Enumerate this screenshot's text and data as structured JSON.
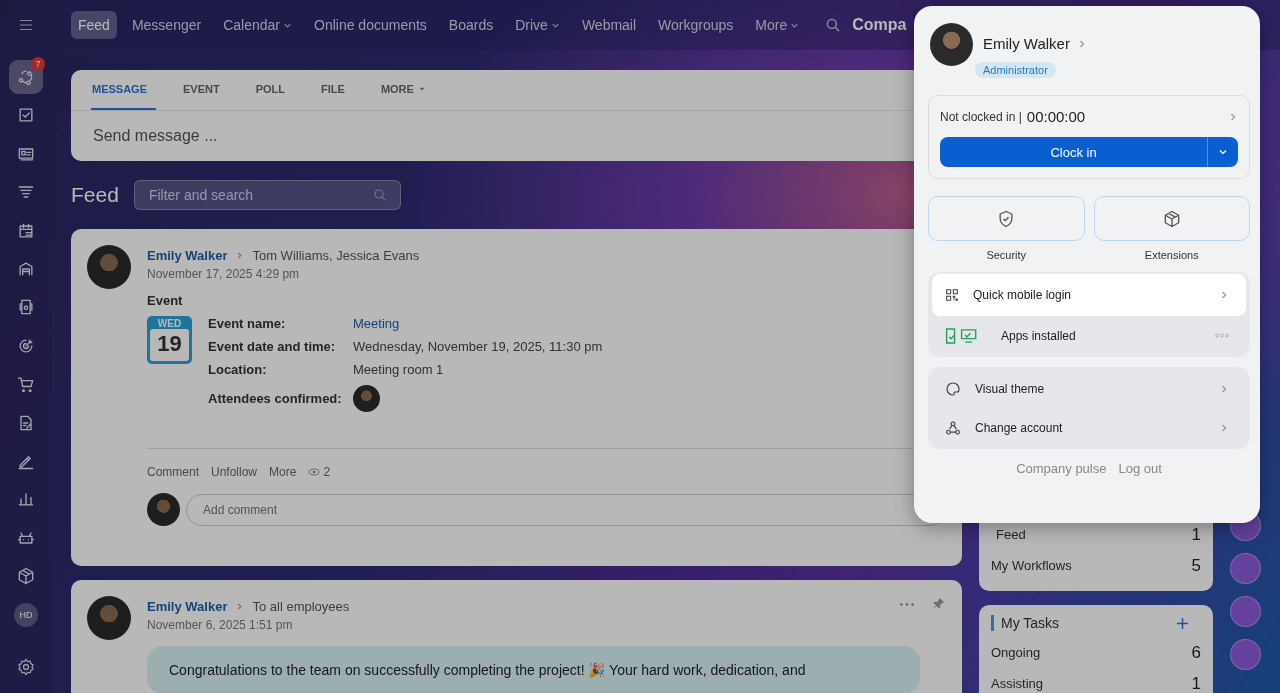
{
  "sidebar": {
    "items": [
      {
        "kind": "feed",
        "selected": true,
        "badge": "7"
      },
      {
        "kind": "tasks",
        "selected": false
      },
      {
        "kind": "crm",
        "selected": false
      },
      {
        "kind": "funnel",
        "selected": false
      },
      {
        "kind": "calendar",
        "selected": false
      },
      {
        "kind": "store",
        "selected": false
      },
      {
        "kind": "device",
        "selected": false
      },
      {
        "kind": "target",
        "selected": false
      },
      {
        "kind": "cart",
        "selected": false
      },
      {
        "kind": "document",
        "selected": false
      },
      {
        "kind": "sign",
        "selected": false
      },
      {
        "kind": "chart",
        "selected": false
      },
      {
        "kind": "robot",
        "selected": false
      },
      {
        "kind": "box",
        "selected": false
      }
    ],
    "avatar_initials": "HD"
  },
  "top_nav": {
    "items": [
      {
        "label": "Feed",
        "selected": true,
        "dropdown": false
      },
      {
        "label": "Messenger",
        "selected": false,
        "dropdown": false
      },
      {
        "label": "Calendar",
        "selected": false,
        "dropdown": true
      },
      {
        "label": "Online documents",
        "selected": false,
        "dropdown": false
      },
      {
        "label": "Boards",
        "selected": false,
        "dropdown": false
      },
      {
        "label": "Drive",
        "selected": false,
        "dropdown": true
      },
      {
        "label": "Webmail",
        "selected": false,
        "dropdown": false
      },
      {
        "label": "Workgroups",
        "selected": false,
        "dropdown": false
      },
      {
        "label": "More",
        "selected": false,
        "dropdown": true
      }
    ],
    "company": "Compa"
  },
  "composer": {
    "tabs": [
      {
        "label": "MESSAGE",
        "selected": true,
        "dropdown": false
      },
      {
        "label": "EVENT",
        "selected": false,
        "dropdown": false
      },
      {
        "label": "POLL",
        "selected": false,
        "dropdown": false
      },
      {
        "label": "FILE",
        "selected": false,
        "dropdown": false
      },
      {
        "label": "MORE",
        "selected": false,
        "dropdown": true
      }
    ],
    "placeholder": "Send message ..."
  },
  "feed": {
    "title": "Feed",
    "filter_placeholder": "Filter and search"
  },
  "posts": [
    {
      "kind": "event",
      "author": "Emily Walker",
      "recipients": "Tom Williams, Jessica Evans",
      "time": "November 17, 2025 4:29 pm",
      "heading": "Event",
      "calendar": {
        "weekday": "WED",
        "day": "19"
      },
      "fields": [
        {
          "label": "Event name:",
          "kind": "link",
          "value": "Meeting"
        },
        {
          "label": "Event date and time:",
          "kind": "text",
          "value": "Wednesday, November 19, 2025, 11:30 pm"
        },
        {
          "label": "Location:",
          "kind": "text",
          "value": "Meeting room 1"
        },
        {
          "label": "Attendees confirmed:",
          "kind": "avatars"
        }
      ],
      "actions": [
        "Comment",
        "Unfollow",
        "More"
      ],
      "views": "2",
      "comment_placeholder": "Add comment"
    },
    {
      "kind": "message",
      "author": "Emily Walker",
      "recipients": "To all employees",
      "time": "November 6, 2025 1:51 pm",
      "message": "Congratulations to the team on successfully completing the project! 🎉 Your hard work, dedication, and"
    }
  ],
  "counters": [
    {
      "label": "Feed",
      "count": "1"
    },
    {
      "label": "My Workflows",
      "count": "5"
    }
  ],
  "tasks": {
    "title": "My Tasks",
    "items": [
      {
        "label": "Ongoing",
        "count": "6"
      },
      {
        "label": "Assisting",
        "count": "1"
      }
    ]
  },
  "popup": {
    "name": "Emily Walker",
    "role": "Administrator",
    "clock": {
      "status": "Not clocked in |",
      "time": "00:00:00",
      "button": "Clock in"
    },
    "tiles": [
      {
        "kind": "shield",
        "label": "Security"
      },
      {
        "kind": "box",
        "label": "Extensions"
      }
    ],
    "menu_1": [
      {
        "kind": "qr",
        "label": "Quick mobile login",
        "selected": true
      },
      {
        "kind": "apps",
        "label": "Apps installed",
        "selected": false
      }
    ],
    "menu_2": [
      {
        "kind": "palette",
        "label": "Visual theme"
      },
      {
        "kind": "account",
        "label": "Change account"
      }
    ],
    "footer_links": [
      "Company pulse",
      "Log out"
    ]
  }
}
